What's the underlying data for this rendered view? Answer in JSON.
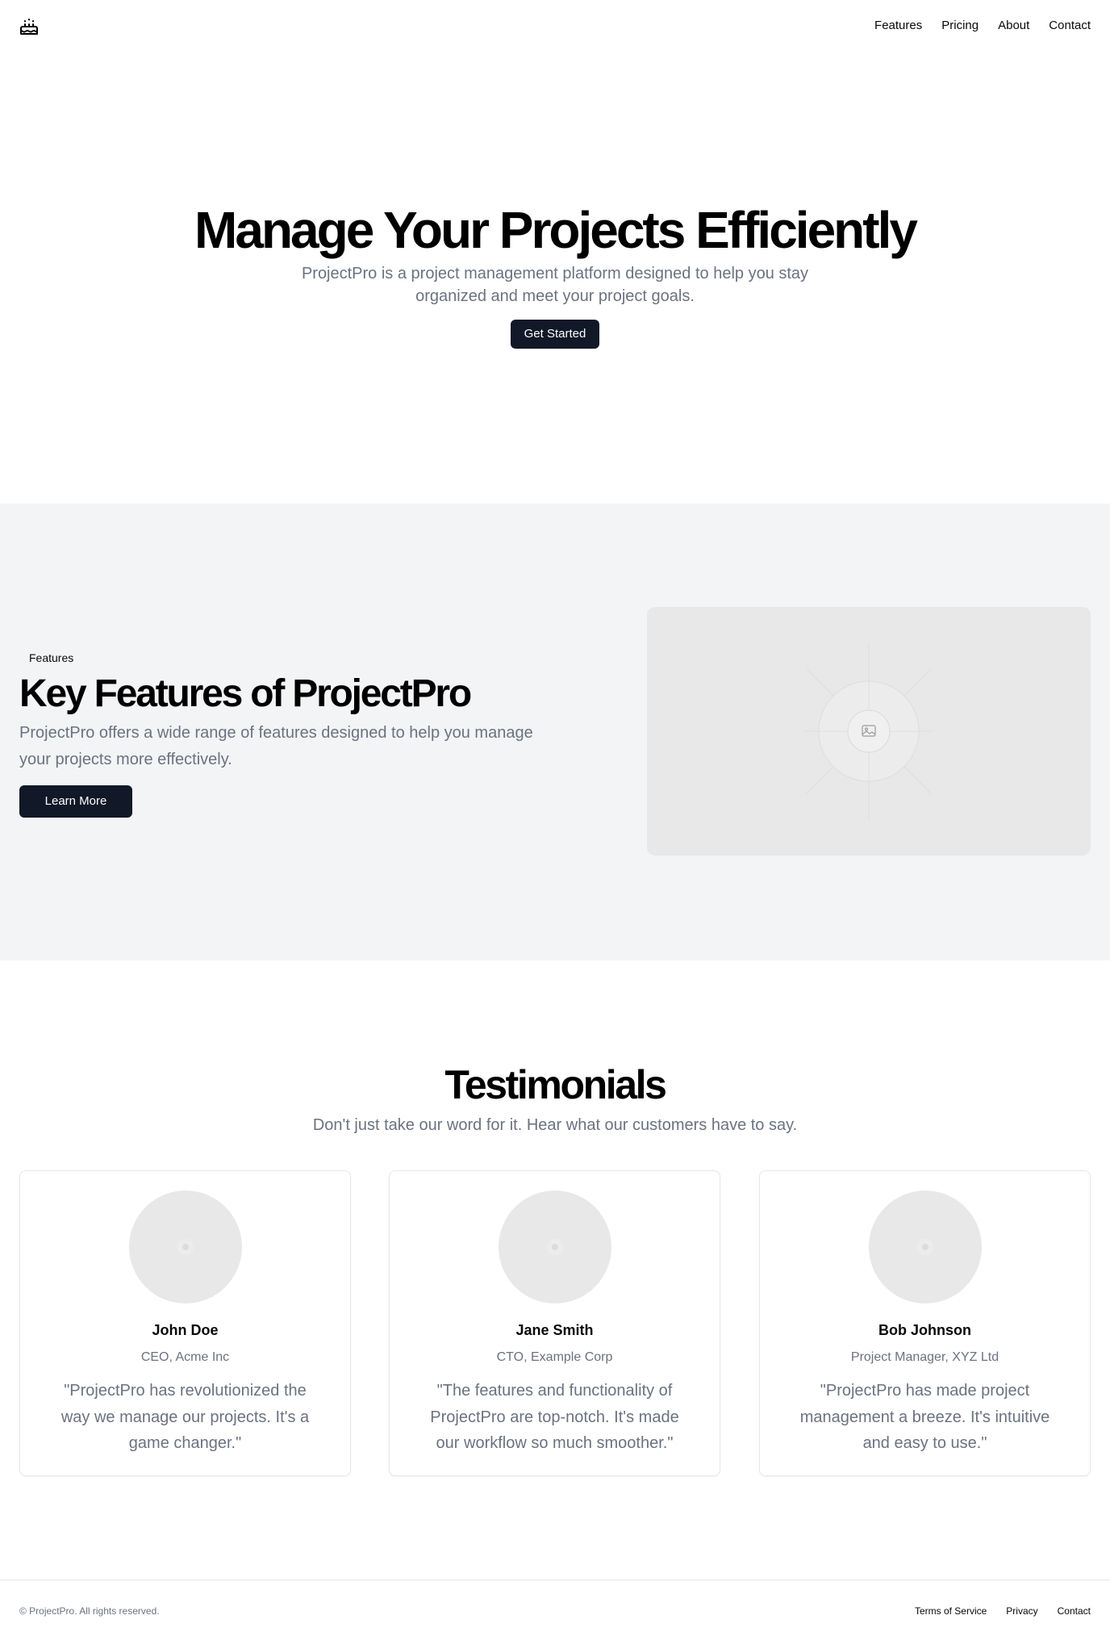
{
  "header": {
    "logo_icon": "cake-icon",
    "nav": [
      {
        "label": "Features"
      },
      {
        "label": "Pricing"
      },
      {
        "label": "About"
      },
      {
        "label": "Contact"
      }
    ]
  },
  "hero": {
    "title": "Manage Your Projects Efficiently",
    "subtitle": "ProjectPro is a project management platform designed to help you stay organized and meet your project goals.",
    "cta_label": "Get Started"
  },
  "features": {
    "badge": "Features",
    "title": "Key Features of ProjectPro",
    "description": "ProjectPro offers a wide range of features designed to help you manage your projects more effectively.",
    "cta_label": "Learn More",
    "image_icon": "image-placeholder-icon"
  },
  "testimonials": {
    "title": "Testimonials",
    "subtitle": "Don't just take our word for it. Hear what our customers have to say.",
    "items": [
      {
        "name": "John Doe",
        "role": "CEO, Acme Inc",
        "quote": "\"ProjectPro has revolutionized the way we manage our projects. It's a game changer.\""
      },
      {
        "name": "Jane Smith",
        "role": "CTO, Example Corp",
        "quote": "\"The features and functionality of ProjectPro are top-notch. It's made our workflow so much smoother.\""
      },
      {
        "name": "Bob Johnson",
        "role": "Project Manager, XYZ Ltd",
        "quote": "\"ProjectPro has made project management a breeze. It's intuitive and easy to use.\""
      }
    ]
  },
  "footer": {
    "copyright": "© ProjectPro. All rights reserved.",
    "links": [
      {
        "label": "Terms of Service"
      },
      {
        "label": "Privacy"
      },
      {
        "label": "Contact"
      }
    ]
  },
  "colors": {
    "primary_button": "#111827",
    "muted_text": "#6b7280",
    "section_bg": "#f3f4f6"
  }
}
